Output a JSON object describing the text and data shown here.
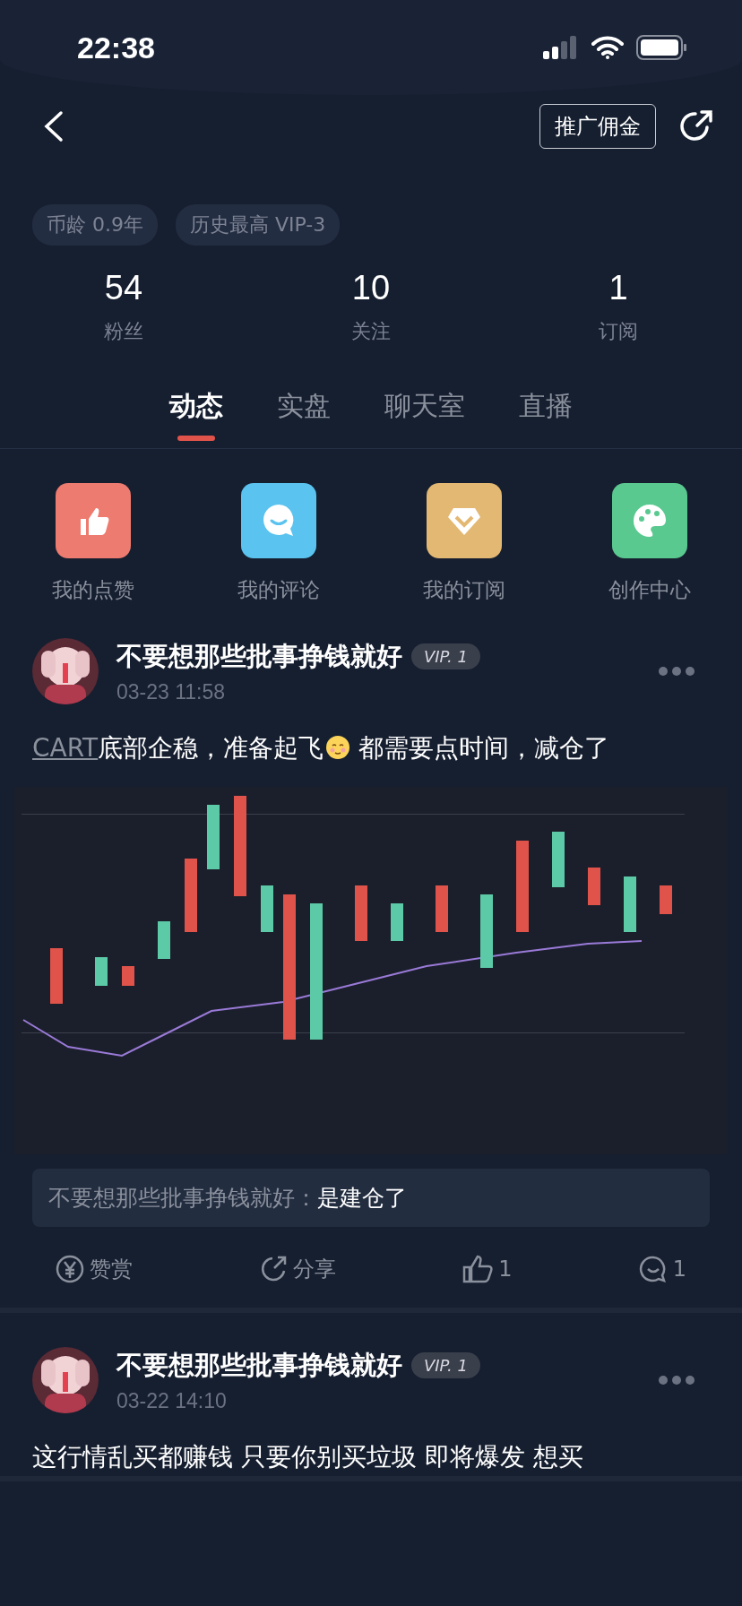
{
  "status_bar": {
    "time": "22:38"
  },
  "header": {
    "promo_button": "推广佣金"
  },
  "profile": {
    "tags": [
      "币龄 0.9年",
      "历史最高 VIP-3"
    ],
    "stats": [
      {
        "value": "54",
        "label": "粉丝"
      },
      {
        "value": "10",
        "label": "关注"
      },
      {
        "value": "1",
        "label": "订阅"
      }
    ]
  },
  "tabs": [
    {
      "label": "动态",
      "selected": true
    },
    {
      "label": "实盘",
      "selected": false
    },
    {
      "label": "聊天室",
      "selected": false
    },
    {
      "label": "直播",
      "selected": false
    }
  ],
  "shortcuts": [
    {
      "kind": "like",
      "label": "我的点赞",
      "color": "#ee7b6f"
    },
    {
      "kind": "comment",
      "label": "我的评论",
      "color": "#5bc3ef"
    },
    {
      "kind": "subscribe",
      "label": "我的订阅",
      "color": "#e3b872"
    },
    {
      "kind": "create",
      "label": "创作中心",
      "color": "#5ac98f"
    }
  ],
  "posts": [
    {
      "author": "不要想那些批事挣钱就好",
      "badge": {
        "mark": "VIP.",
        "rank": "1"
      },
      "date": "03-23 11:58",
      "body": [
        {
          "kind": "link",
          "text": "CART"
        },
        {
          "kind": "text",
          "text": "底部企稳，准备起飞"
        },
        {
          "kind": "emoji"
        },
        {
          "kind": "text",
          "text": " 都需要点时间，减仓了"
        }
      ],
      "comment": {
        "author": "不要想那些批事挣钱就好：",
        "text": "是建仓了"
      },
      "actions": [
        {
          "kind": "reward",
          "text": "赞赏"
        },
        {
          "kind": "share",
          "text": "分享"
        },
        {
          "kind": "like",
          "text": "1"
        },
        {
          "kind": "comment",
          "text": "1"
        }
      ]
    },
    {
      "author": "不要想那些批事挣钱就好",
      "badge": {
        "mark": "VIP.",
        "rank": "1"
      },
      "date": "03-22 14:10",
      "body": [
        {
          "kind": "text",
          "text": "这行情乱买都赚钱 只要你别买垃圾 即将爆发 想买"
        }
      ]
    }
  ]
}
